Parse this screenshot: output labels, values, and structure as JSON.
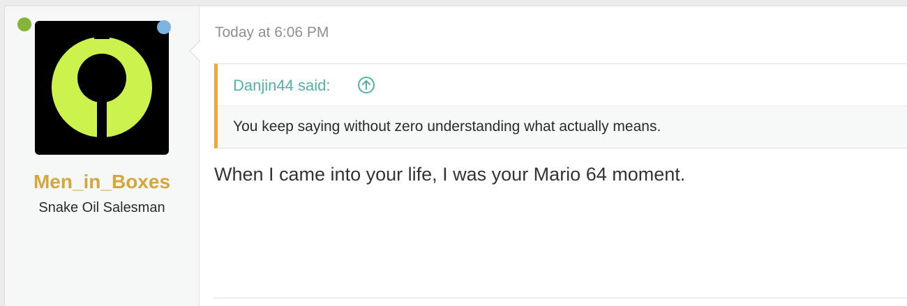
{
  "post": {
    "user": {
      "name": "Men_in_Boxes",
      "title": "Snake Oil Salesman",
      "avatar_icon": "keyhole-logo-icon",
      "name_color": "#d6a63c",
      "online_color": "#84b53a",
      "extra_dot_color": "#7db3e0"
    },
    "timestamp": "Today at 6:06 PM",
    "quote": {
      "author": "Danjin44 said:",
      "text": "You keep saying without zero understanding what actually means.",
      "up_icon": "arrow-up-circle-icon",
      "accent_color": "#f2a53a",
      "author_color": "#4fb3a8"
    },
    "message": "When I came into your life, I was your Mario 64 moment."
  }
}
